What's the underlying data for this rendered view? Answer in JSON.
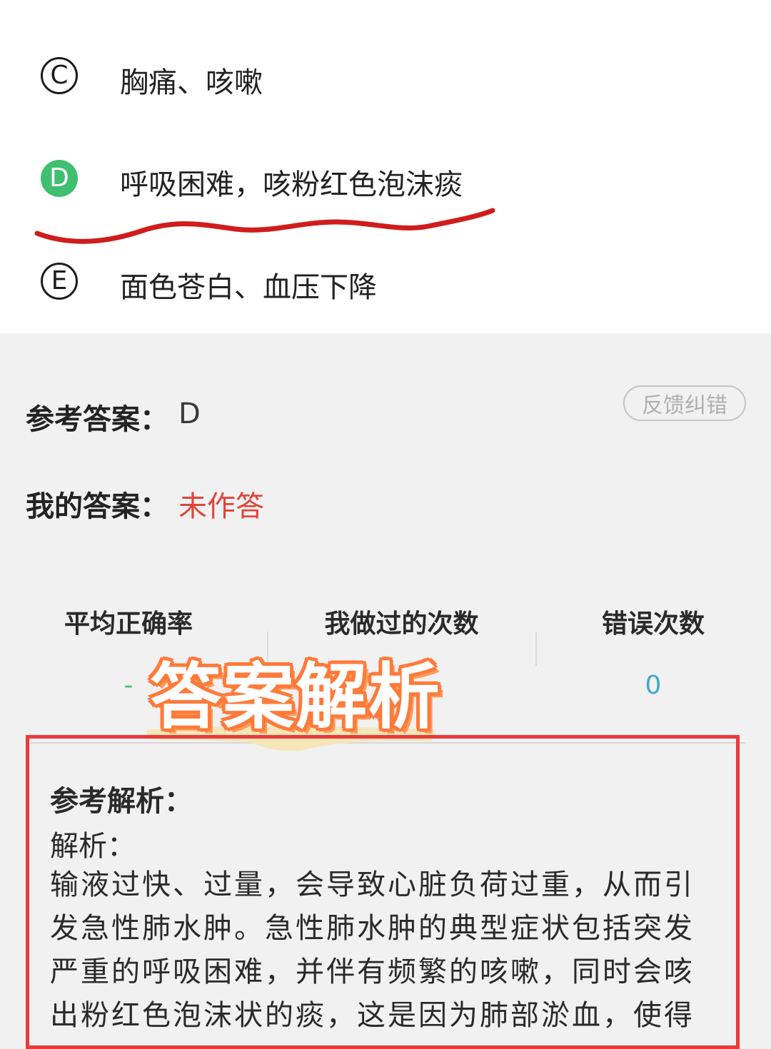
{
  "options": [
    {
      "letter": "C",
      "text": "胸痛、咳嗽",
      "correct": false
    },
    {
      "letter": "D",
      "text": "呼吸困难，咳粉红色泡沫痰",
      "correct": true
    },
    {
      "letter": "E",
      "text": "面色苍白、血压下降",
      "correct": false
    }
  ],
  "answer": {
    "reference_label": "参考答案：",
    "reference_value": "D",
    "mine_label": "我的答案：",
    "mine_value": "未作答",
    "feedback_label": "反馈纠错"
  },
  "stats": {
    "headers": [
      "平均正确率",
      "我做过的次数",
      "错误次数"
    ],
    "accuracy": "-",
    "errors": "0"
  },
  "overlay": {
    "title": "答案解析"
  },
  "analysis": {
    "title": "参考解析：",
    "subtitle": "解析：",
    "body": "输液过快、过量，会导致心脏负荷过重，从而引发急性肺水肿。急性肺水肿的典型症状包括突发严重的呼吸困难，并伴有频繁的咳嗽，同时会咳出粉红色泡沫状的痰，这是因为肺部淤血，使得"
  },
  "colors": {
    "correct": "#3fbf6f",
    "unanswered": "#e0443a",
    "stat_value": "#46a6c6",
    "highlight_border": "#ea3a3a",
    "overlay_outline": "#ff7a3a",
    "annotation_wave": "#d01c1c"
  }
}
